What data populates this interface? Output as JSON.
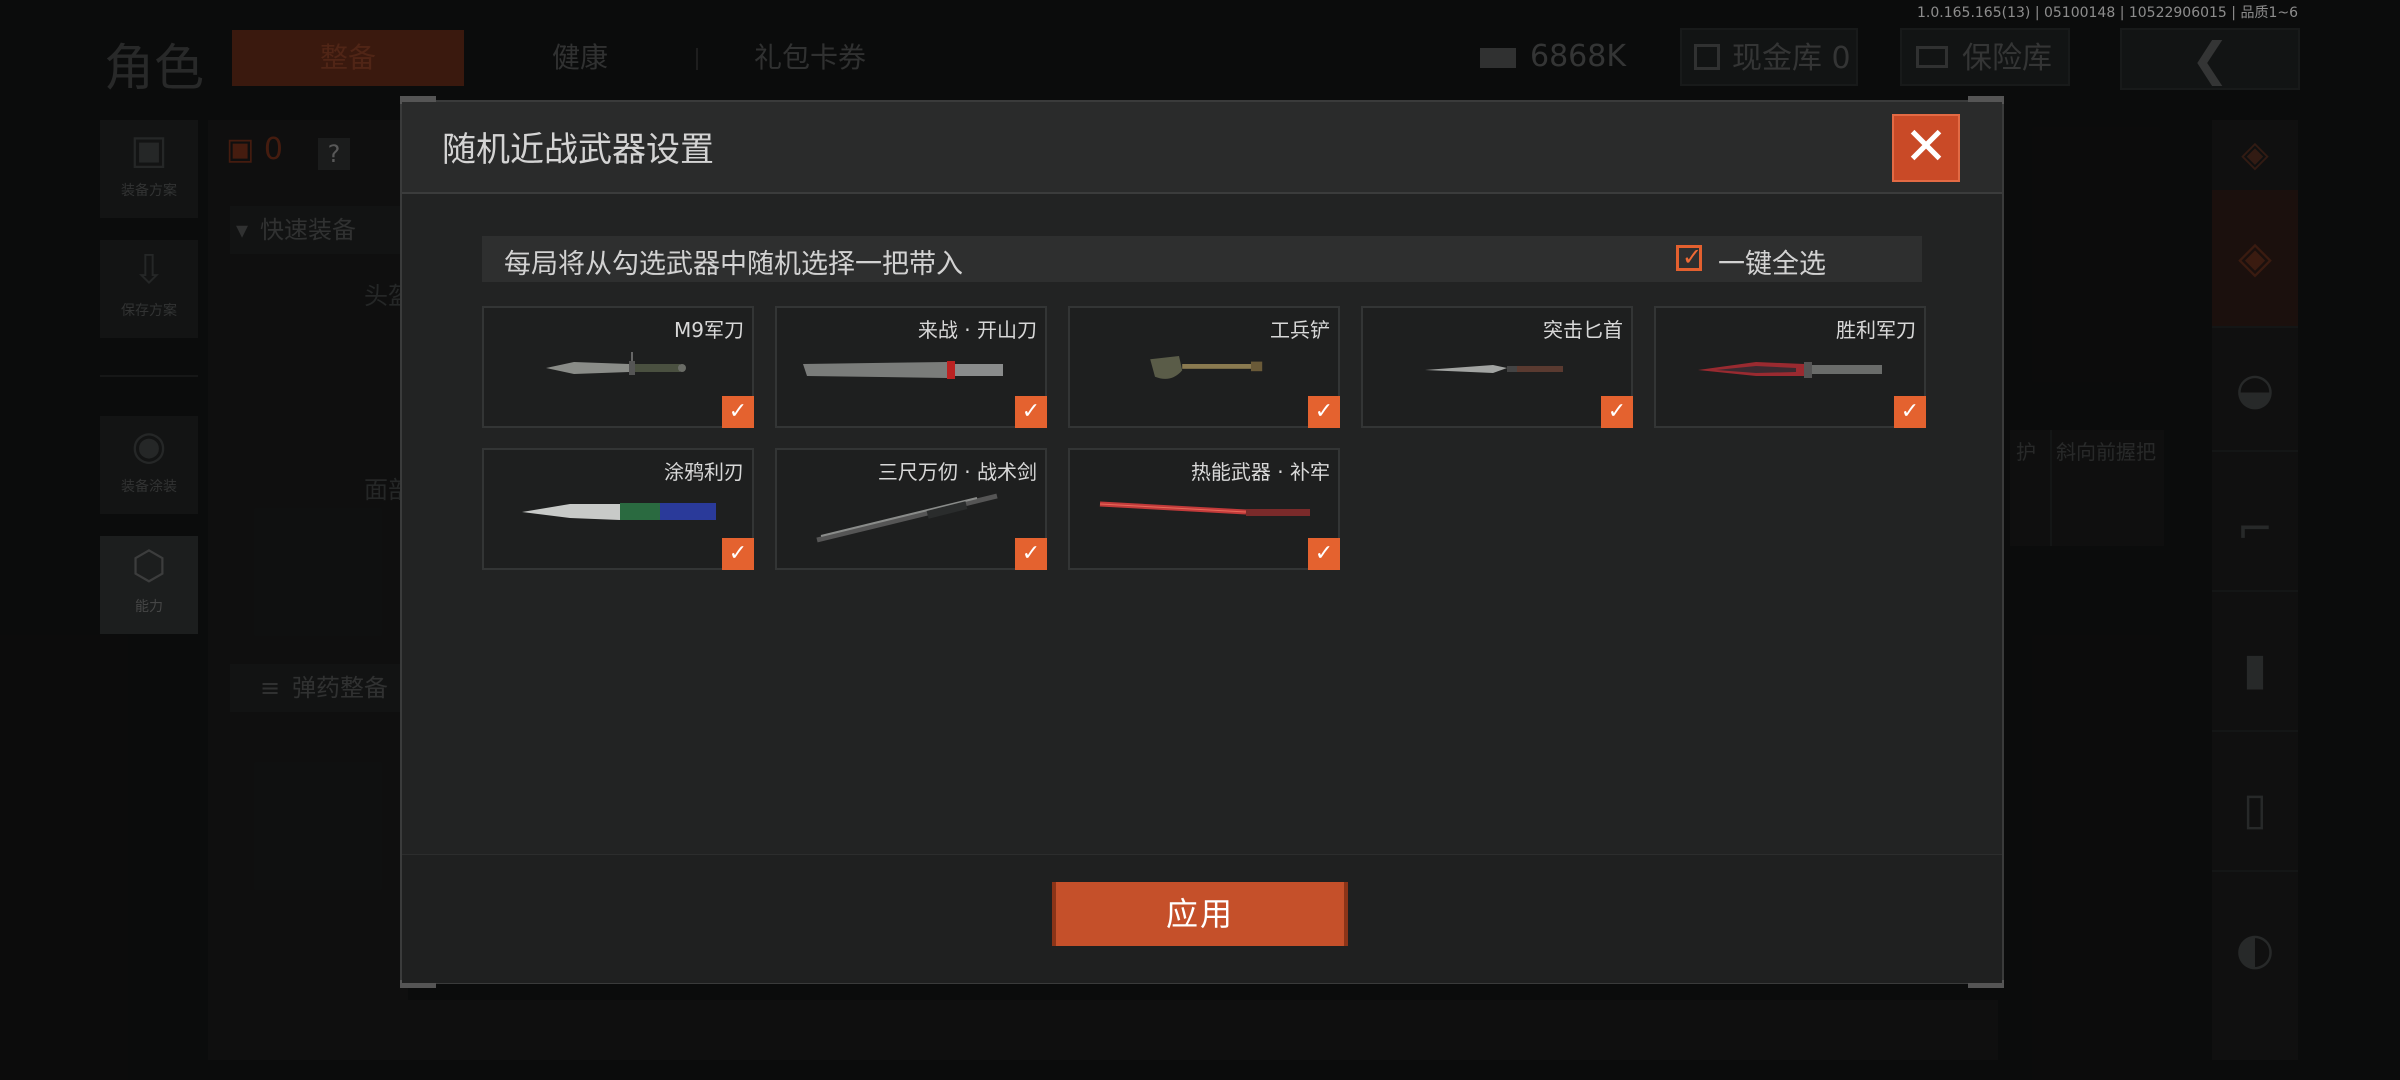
{
  "background": {
    "page_title": "角色",
    "tabs": [
      {
        "label": "整备"
      },
      {
        "label": "健康"
      },
      {
        "label": "礼包卡券"
      }
    ],
    "version_text": "1.0.165.165(13) | 05100148 | 10522906015 | 品质1~6",
    "currency": {
      "value": "6868K"
    },
    "cash_vault": {
      "label": "现金库 0"
    },
    "safe_vault": {
      "label": "保险库"
    },
    "side_menu": [
      {
        "label": "装备方案"
      },
      {
        "label": "保存方案"
      },
      {
        "label": "装备涂装"
      },
      {
        "label": "能力"
      }
    ],
    "weight_count": "0",
    "help_label": "?",
    "quick_equip": "快速装备",
    "head_slot": "头盔",
    "face_slot": "面部",
    "ammo_label": "弹药整备",
    "guard_label": "护",
    "grip_label": "斜向前握把"
  },
  "modal": {
    "title": "随机近战武器设置",
    "subtitle": "每局将从勾选武器中随机选择一把带入",
    "select_all_label": "一键全选",
    "select_all_checked": true,
    "apply_label": "应用",
    "weapons": [
      {
        "name": "M9军刀",
        "checked": true
      },
      {
        "name": "来战 · 开山刀",
        "checked": true
      },
      {
        "name": "工兵铲",
        "checked": true
      },
      {
        "name": "突击匕首",
        "checked": true
      },
      {
        "name": "胜利军刀",
        "checked": true
      },
      {
        "name": "涂鸦利刃",
        "checked": true
      },
      {
        "name": "三尺万仞 · 战术剑",
        "checked": true
      },
      {
        "name": "热能武器 · 补牢",
        "checked": true
      }
    ]
  },
  "colors": {
    "accent": "#e4622f",
    "modal_bg": "#222323"
  }
}
